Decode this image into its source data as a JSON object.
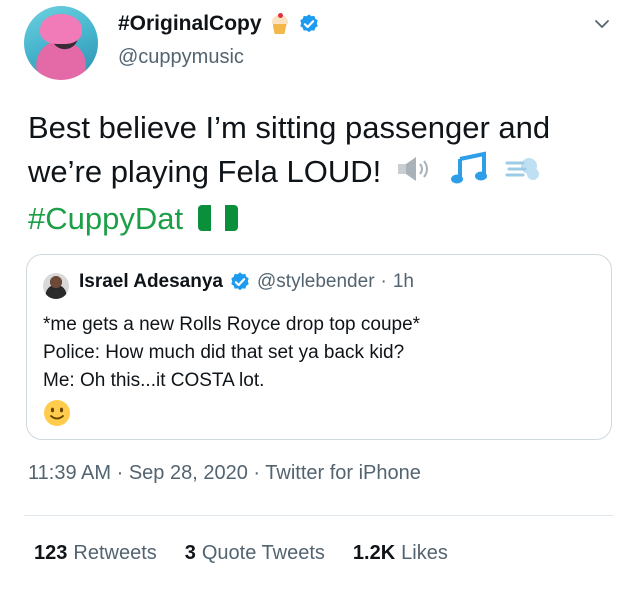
{
  "author": {
    "display_name": "#OriginalCopy",
    "handle": "@cuppymusic",
    "avatar_icon": "profile-photo",
    "name_emoji": "cupcake-icon",
    "verified": true
  },
  "tweet": {
    "text_line": "Best believe I’m sitting passenger and we’re playing Fela LOUD!",
    "hashtag": "#CuppyDat",
    "emojis": [
      "speaker-loud-icon",
      "musical-notes-icon",
      "dash-icon",
      "nigeria-flag-icon"
    ]
  },
  "quote": {
    "name": "Israel Adesanya",
    "handle": "@stylebender",
    "separator": "·",
    "time": "1h",
    "lines": [
      "*me gets a new Rolls Royce drop top coupe*",
      "Police: How much did that set ya back kid?",
      "Me: Oh this...it COSTA lot."
    ],
    "emoji": "slightly-smiling-face-icon"
  },
  "meta": {
    "time": "11:39 AM",
    "date": "Sep 28, 2020",
    "source": "Twitter for iPhone",
    "separator": "·"
  },
  "stats": {
    "retweets_count": "123",
    "retweets_label": "Retweets",
    "quotes_count": "3",
    "quotes_label": "Quote Tweets",
    "likes_count": "1.2K",
    "likes_label": "Likes"
  },
  "colors": {
    "verified_blue": "#1d9bf0",
    "hashtag_green": "#1d9f47",
    "secondary_text": "#536471"
  }
}
